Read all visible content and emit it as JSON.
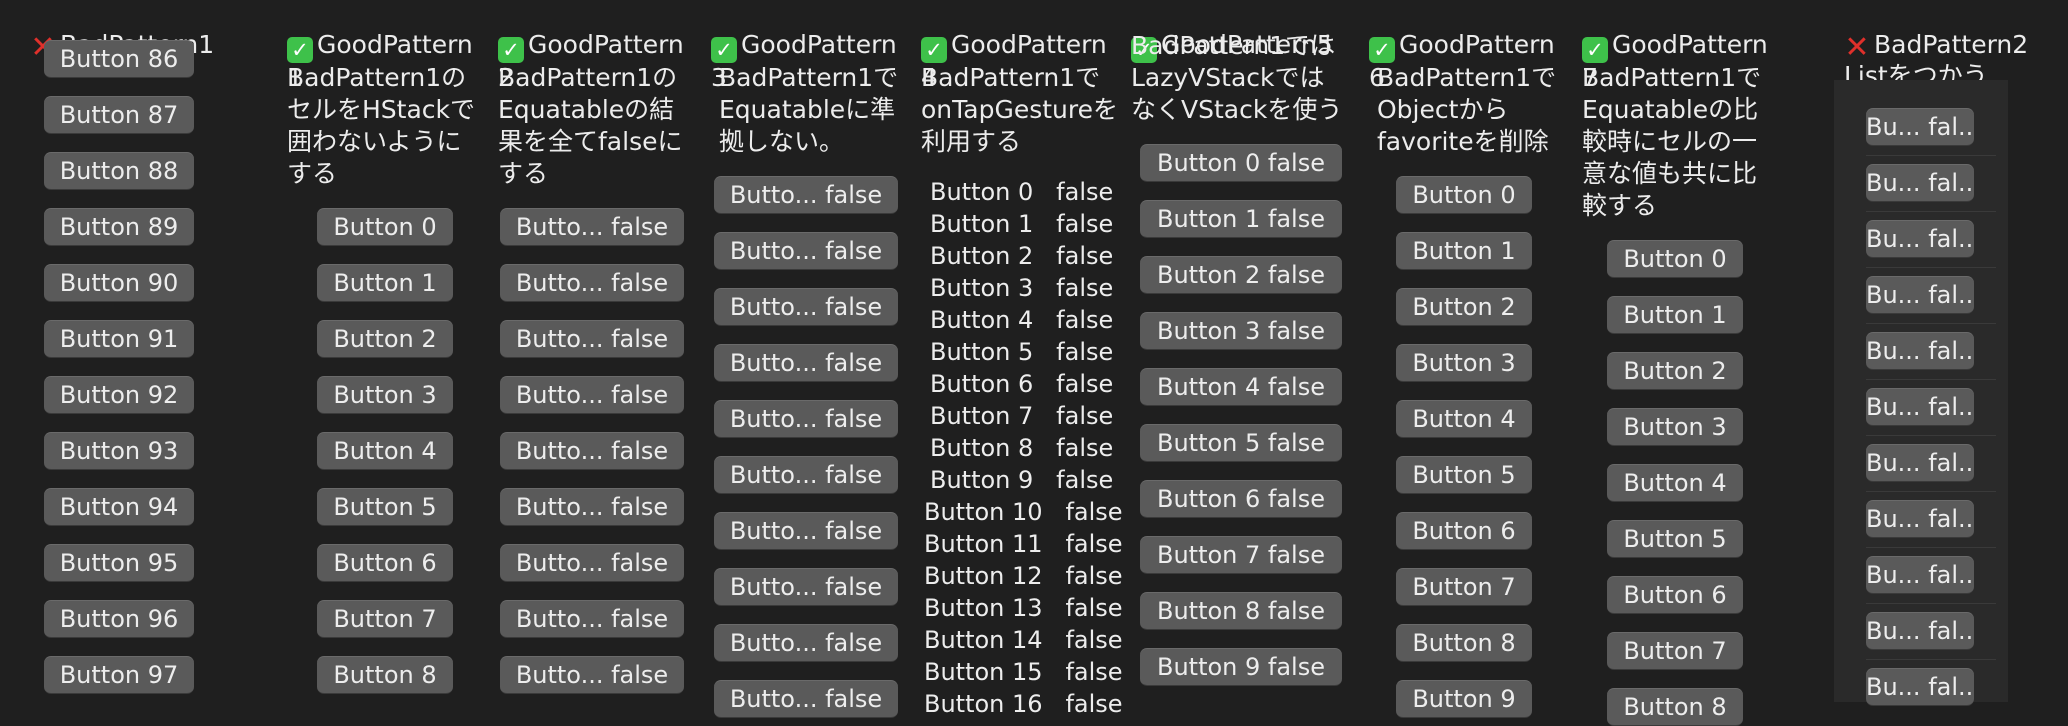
{
  "columns": [
    {
      "title": "BadPattern1",
      "status": "bad"
    },
    {
      "title": "GoodPattern\n1",
      "status": "good",
      "description": "BadPattern1の\nセルをHStackで\n囲わないように\nする"
    },
    {
      "title": "GoodPattern\n2",
      "status": "good",
      "description": "BadPattern1の\nEquatableの結\n果を全てfalseに\nする"
    },
    {
      "title": "GoodPattern\n3",
      "status": "good",
      "description": "BadPattern1で\nEquatableに準\n拠しない。"
    },
    {
      "title": "GoodPattern\n4",
      "status": "good",
      "description": "BadPattern1で\nonTapGestureを\n利用する"
    },
    {
      "title": "GoodPattern5",
      "status": "good",
      "description": "BadPattern1では\nLazyVStackでは\nなくVStackを使う"
    },
    {
      "title": "GoodPattern\n6",
      "status": "good",
      "description": "BadPattern1で\nObjectから\nfavoriteを削除"
    },
    {
      "title": "GoodPattern\n7",
      "status": "good",
      "description": "BadPattern1で\nEquatableの比\n較時にセルの一\n意な値も共に比\n較する"
    },
    {
      "title": "BadPattern2\nListをつかう",
      "status": "bad"
    }
  ],
  "bad1_buttons": [
    "Button 86",
    "Button 87",
    "Button 88",
    "Button 89",
    "Button 90",
    "Button 91",
    "Button 92",
    "Button 93",
    "Button 94",
    "Button 95",
    "Button 96",
    "Button 97"
  ],
  "good1_buttons": [
    "Button 0",
    "Button 1",
    "Button 2",
    "Button 3",
    "Button 4",
    "Button 5",
    "Button 6",
    "Button 7",
    "Button 8"
  ],
  "good2_buttons": [
    "Butto... false",
    "Butto... false",
    "Butto... false",
    "Butto... false",
    "Butto... false",
    "Butto... false",
    "Butto... false",
    "Butto... false",
    "Butto... false"
  ],
  "good3_buttons": [
    "Butto... false",
    "Butto... false",
    "Butto... false",
    "Butto... false",
    "Butto... false",
    "Butto... false",
    "Butto... false",
    "Butto... false",
    "Butto... false",
    "Butto... false"
  ],
  "good4_rows": [
    "Button 0   false",
    "Button 1   false",
    "Button 2   false",
    "Button 3   false",
    "Button 4   false",
    "Button 5   false",
    "Button 6   false",
    "Button 7   false",
    "Button 8   false",
    "Button 9   false",
    "Button 10   false",
    "Button 11   false",
    "Button 12   false",
    "Button 13   false",
    "Button 14   false",
    "Button 15   false",
    "Button 16   false"
  ],
  "good5_buttons": [
    "Button 0 false",
    "Button 1 false",
    "Button 2 false",
    "Button 3 false",
    "Button 4 false",
    "Button 5 false",
    "Button 6 false",
    "Button 7 false",
    "Button 8 false",
    "Button 9 false"
  ],
  "good6_buttons": [
    "Button 0",
    "Button 1",
    "Button 2",
    "Button 3",
    "Button 4",
    "Button 5",
    "Button 6",
    "Button 7",
    "Button 8",
    "Button 9"
  ],
  "good7_buttons": [
    "Button 0",
    "Button 1",
    "Button 2",
    "Button 3",
    "Button 4",
    "Button 5",
    "Button 6",
    "Button 7",
    "Button 8"
  ],
  "bad2_buttons": [
    "Bu... fal...",
    "Bu... fal...",
    "Bu... fal...",
    "Bu... fal...",
    "Bu... fal...",
    "Bu... fal...",
    "Bu... fal...",
    "Bu... fal...",
    "Bu... fal...",
    "Bu... fal...",
    "Bu... fal..."
  ]
}
